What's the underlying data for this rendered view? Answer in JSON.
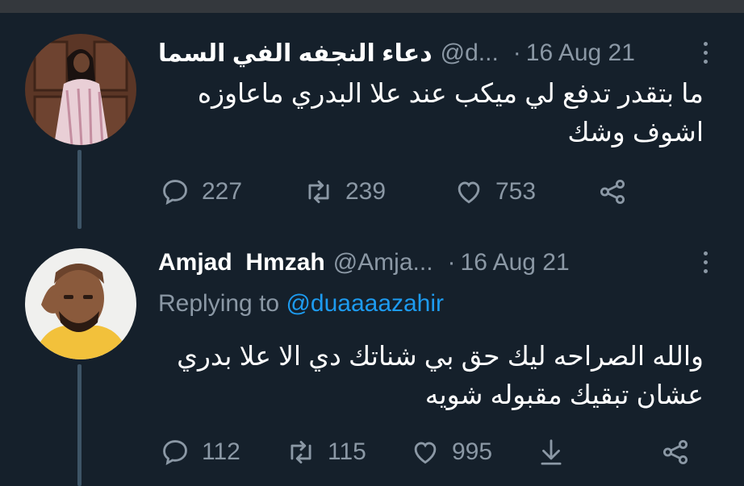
{
  "tweets": [
    {
      "name": "دعاء النجفه الفي السما",
      "handle": "@d...",
      "date": "16 Aug 21",
      "text_lines": [
        "ما بتقدر تدفع لي ميكب عند علا البدري ماعاوزه",
        "اشوف وشك"
      ],
      "replies": "227",
      "retweets": "239",
      "likes": "753",
      "icons": [
        "reply-icon",
        "retweet-icon",
        "like-icon",
        "share-icon"
      ]
    },
    {
      "name": "Amjad  Hmzah",
      "handle": "@Amja...",
      "date": "16 Aug 21",
      "replying_prefix": "Replying to",
      "replying_mention": "@duaaaazahir",
      "text_lines": [
        "والله الصراحه ليك حق بي شناتك دي الا علا بدري",
        "عشان تبقيك مقبوله شويه"
      ],
      "replies": "112",
      "retweets": "115",
      "likes": "995",
      "icons": [
        "reply-icon",
        "retweet-icon",
        "like-icon",
        "download-icon",
        "share-icon"
      ]
    }
  ],
  "colors": {
    "background": "#15202b",
    "secondary_text": "#8b98a5",
    "mention": "#1d9bf0",
    "thread_line": "#3d5466"
  }
}
